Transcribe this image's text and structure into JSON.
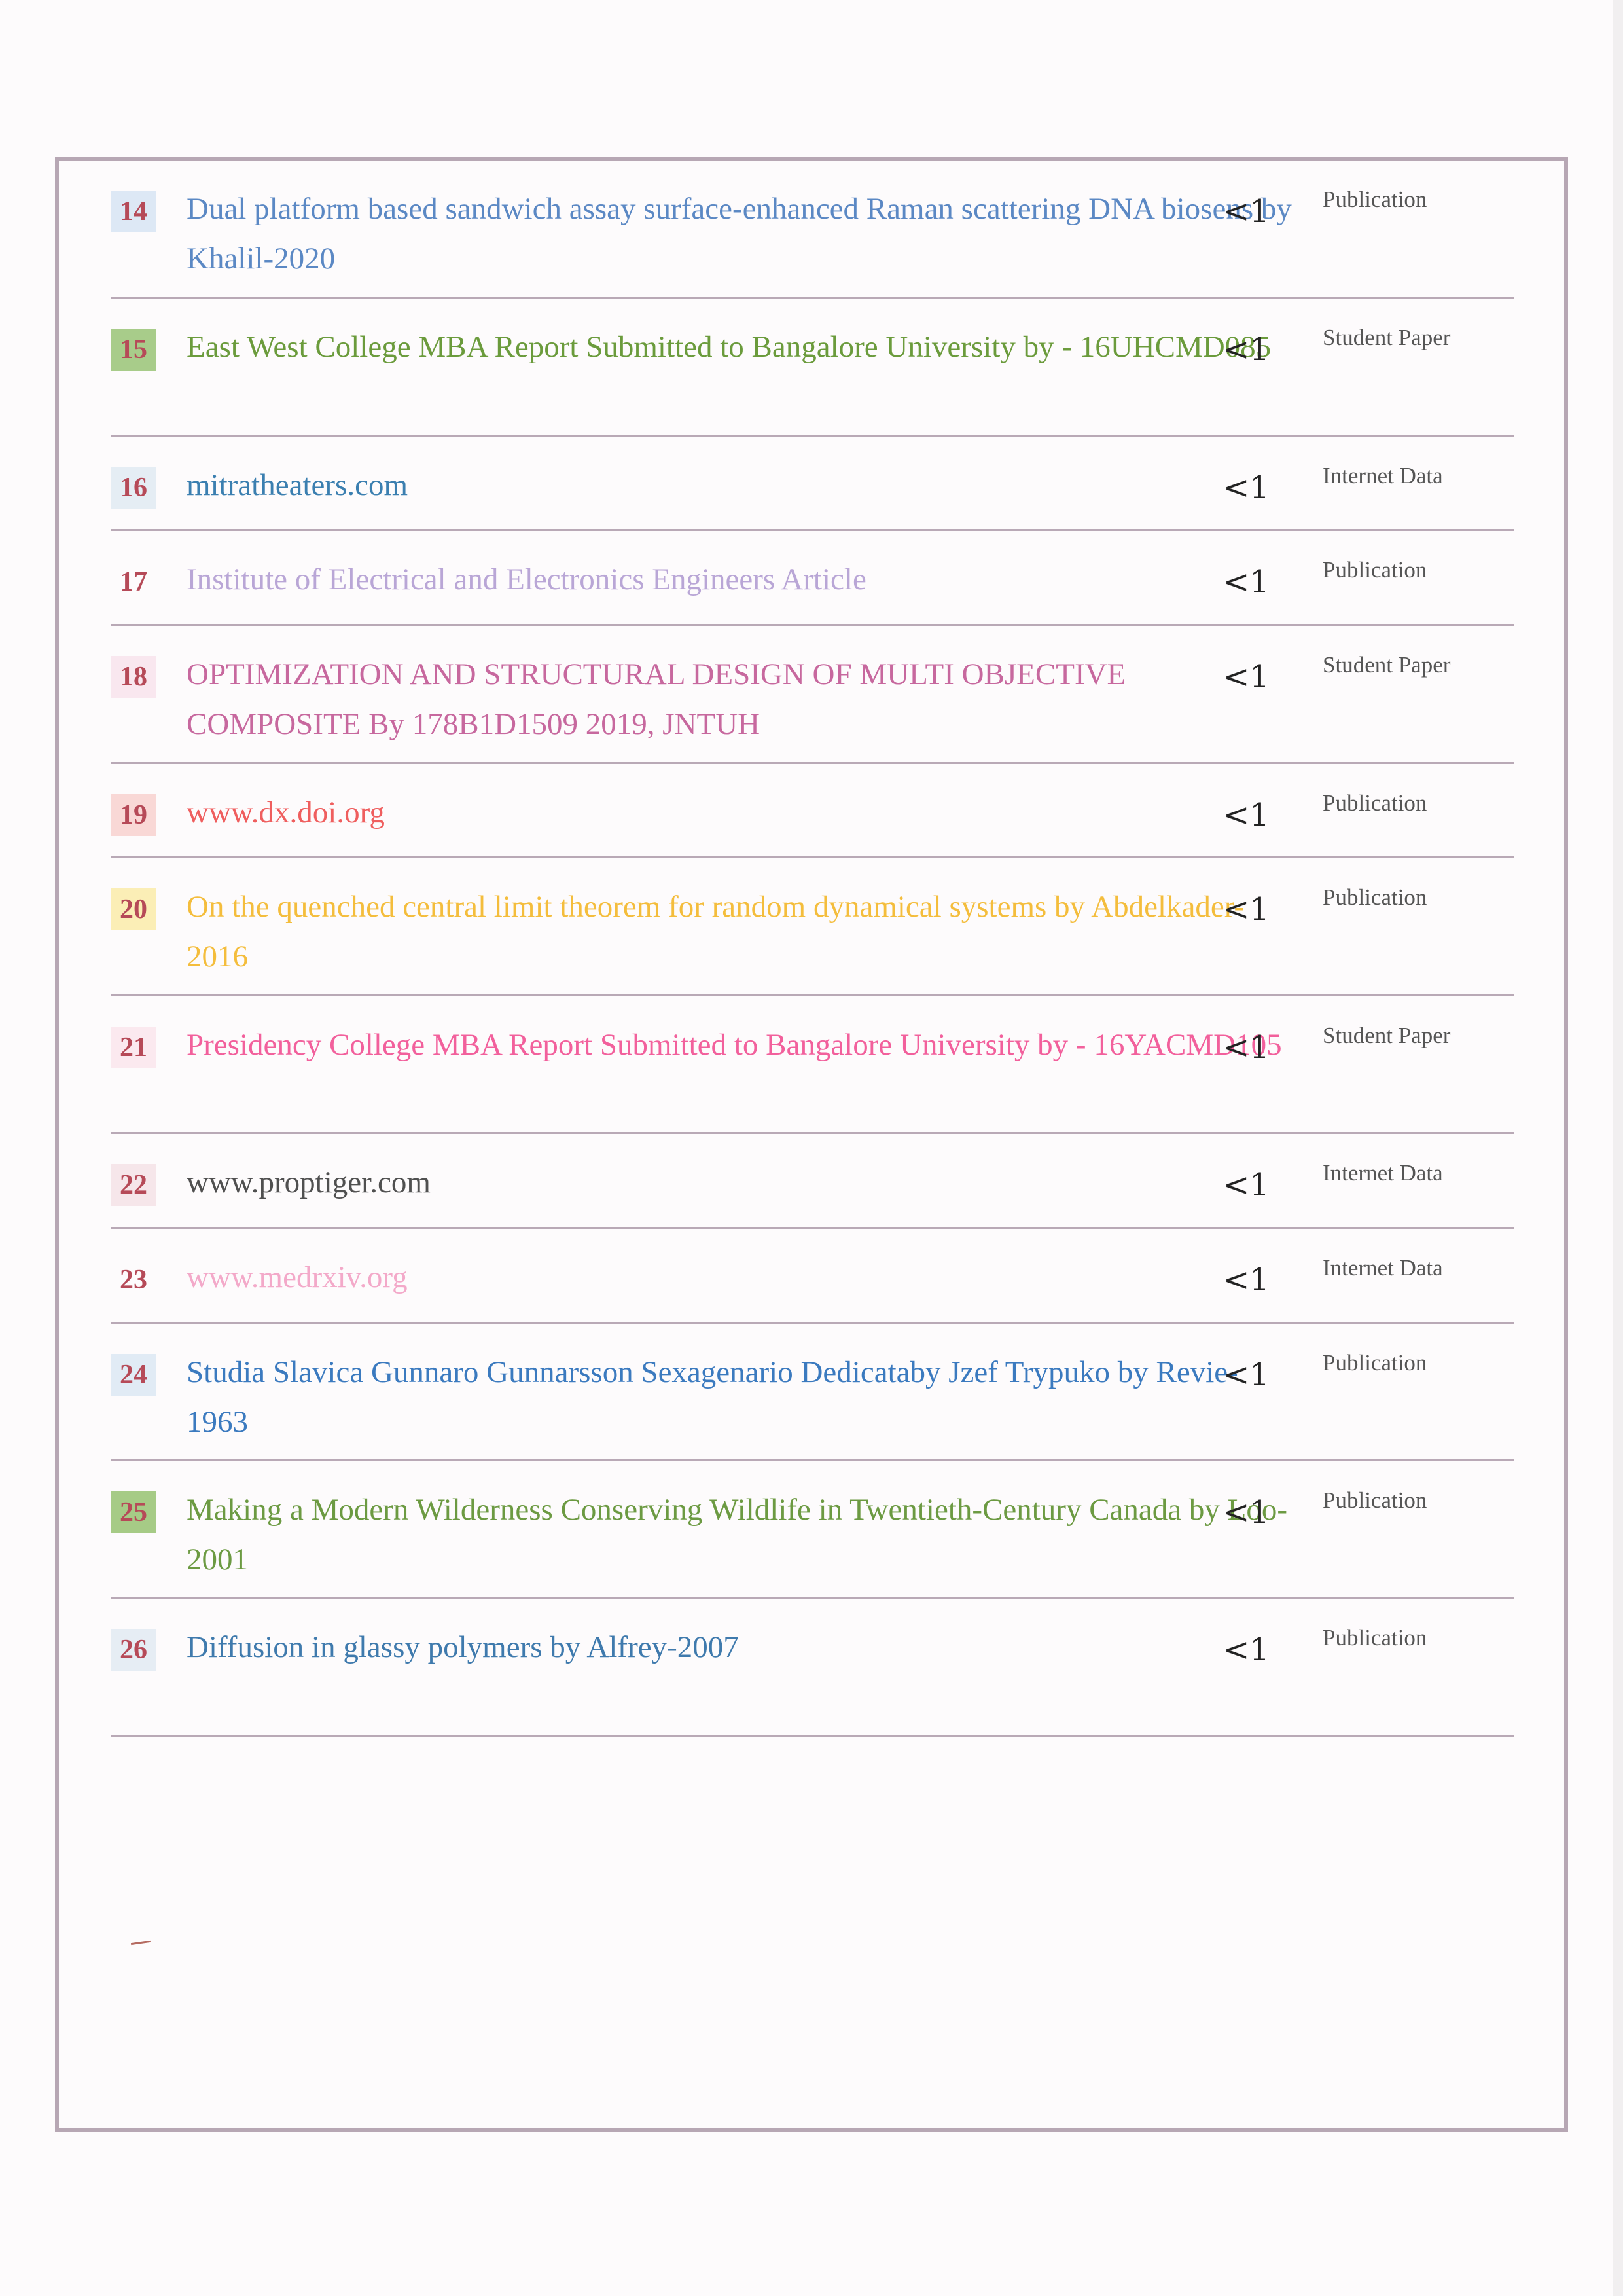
{
  "colors": {
    "frame": "#b7a7b4",
    "divider": "#b9a9b6",
    "number_text": "#b64a58",
    "percent_text": "#222222",
    "type_text": "#555555"
  },
  "sources": [
    {
      "num": "14",
      "title": "Dual platform based sandwich assay surface-enhanced Raman scattering DNA biosens by Khalil-2020",
      "percent": "<1",
      "type": "Publication",
      "color": "#5b88c4",
      "badge": "#dde8f5",
      "lines": 2
    },
    {
      "num": "15",
      "title": "East West College MBA Report Submitted to Bangalore University by - 16UHCMD085",
      "percent": "<1",
      "type": "Student Paper",
      "color": "#6b9b3c",
      "badge": "#a8cc8a",
      "lines": 2
    },
    {
      "num": "16",
      "title": "mitratheaters.com",
      "percent": "<1",
      "type": "Internet Data",
      "color": "#3b7fb0",
      "badge": "#e5edf4",
      "lines": 1
    },
    {
      "num": "17",
      "title": "Institute of Electrical and Electronics Engineers Article",
      "percent": "<1",
      "type": "Publication",
      "color": "#b9a6d6",
      "badge": "#fdfbfc",
      "lines": 1
    },
    {
      "num": "18",
      "title": "OPTIMIZATION AND STRUCTURAL DESIGN OF MULTI OBJECTIVE COMPOSITE By 178B1D1509 2019, JNTUH",
      "percent": "<1",
      "type": "Student Paper",
      "color": "#c7689e",
      "badge": "#f9e7ef",
      "lines": 2
    },
    {
      "num": "19",
      "title": "www.dx.doi.org",
      "percent": "<1",
      "type": "Publication",
      "color": "#ef5e5e",
      "badge": "#f9d8d6",
      "lines": 1
    },
    {
      "num": "20",
      "title": "On the quenched central limit theorem for random dynamical systems by Abdelkader-2016",
      "percent": "<1",
      "type": "Publication",
      "color": "#f4bd3c",
      "badge": "#fbeeb6",
      "lines": 2
    },
    {
      "num": "21",
      "title": "Presidency College MBA Report Submitted to Bangalore University by - 16YACMD105",
      "percent": "<1",
      "type": "Student Paper",
      "color": "#f2609c",
      "badge": "#fbe9ef",
      "lines": 2
    },
    {
      "num": "22",
      "title": "www.proptiger.com",
      "percent": "<1",
      "type": "Internet Data",
      "color": "#505050",
      "badge": "#f6e6ea",
      "lines": 1
    },
    {
      "num": "23",
      "title": "www.medrxiv.org",
      "percent": "<1",
      "type": "Internet Data",
      "color": "#f3a9c9",
      "badge": "#fdfbfc",
      "lines": 1
    },
    {
      "num": "24",
      "title": "Studia Slavica Gunnaro Gunnarsson Sexagenario Dedicataby Jzef Trypuko by Revie-1963",
      "percent": "<1",
      "type": "Publication",
      "color": "#3b7abf",
      "badge": "#e1ebf5",
      "lines": 2
    },
    {
      "num": "25",
      "title": "Making a Modern Wilderness Conserving Wildlife in Twentieth-Century Canada by Loo-2001",
      "percent": "<1",
      "type": "Publication",
      "color": "#6c9a42",
      "badge": "#a6cb86",
      "lines": 2
    },
    {
      "num": "26",
      "title": "Diffusion in glassy polymers by Alfrey-2007",
      "percent": "<1",
      "type": "Publication",
      "color": "#3f7aad",
      "badge": "#e6edf4",
      "lines": 1
    }
  ]
}
